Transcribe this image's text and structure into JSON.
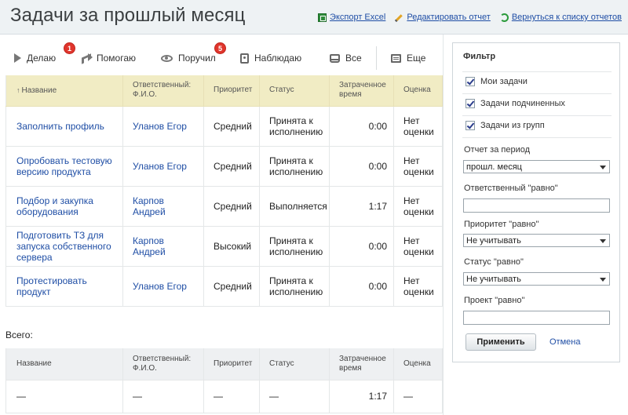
{
  "header": {
    "title": "Задачи за прошлый месяц",
    "links": [
      {
        "label": "Экспорт Excel",
        "icon": "excel-icon"
      },
      {
        "label": "Редактировать отчет",
        "icon": "pencil-icon"
      },
      {
        "label": "Вернуться к списку отчетов",
        "icon": "back-arrow-icon"
      }
    ]
  },
  "tabs": [
    {
      "label": "Делаю",
      "icon": "play-icon",
      "badge": "1"
    },
    {
      "label": "Помогаю",
      "icon": "arrow-right-icon"
    },
    {
      "label": "Поручил",
      "icon": "eye-icon",
      "badge": "5"
    },
    {
      "label": "Наблюдаю",
      "icon": "contact-book-icon"
    },
    {
      "label": "Все",
      "icon": "inbox-icon"
    },
    {
      "label": "Еще",
      "icon": "list-icon"
    }
  ],
  "table": {
    "sort_indicator": "↑",
    "columns": [
      "Название",
      "Ответственный: Ф.И.О.",
      "Приоритет",
      "Статус",
      "Затраченное время",
      "Оценка"
    ],
    "rows": [
      {
        "name": "Заполнить профиль",
        "person": "Уланов Егор",
        "priority": "Средний",
        "status": "Принята к исполнению",
        "time": "0:00",
        "rating": "Нет оценки"
      },
      {
        "name": "Опробовать тестовую версию продукта",
        "person": "Уланов Егор",
        "priority": "Средний",
        "status": "Принята к исполнению",
        "time": "0:00",
        "rating": "Нет оценки"
      },
      {
        "name": "Подбор и закупка оборудования",
        "person": "Карпов Андрей",
        "priority": "Средний",
        "status": "Выполняется",
        "time": "1:17",
        "rating": "Нет оценки"
      },
      {
        "name": "Подготовить ТЗ для запуска собственного сервера",
        "person": "Карпов Андрей",
        "priority": "Высокий",
        "status": "Принята к исполнению",
        "time": "0:00",
        "rating": "Нет оценки"
      },
      {
        "name": "Протестировать продукт",
        "person": "Уланов Егор",
        "priority": "Средний",
        "status": "Принята к исполнению",
        "time": "0:00",
        "rating": "Нет оценки"
      }
    ]
  },
  "totals": {
    "label": "Всего:",
    "columns": [
      "Название",
      "Ответственный: Ф.И.О.",
      "Приоритет",
      "Статус",
      "Затраченное время",
      "Оценка"
    ],
    "row": {
      "name": "—",
      "person": "—",
      "priority": "—",
      "status": "—",
      "time": "1:17",
      "rating": "—"
    }
  },
  "filter": {
    "title": "Фильтр",
    "checkboxes": [
      {
        "label": "Мои задачи",
        "checked": true
      },
      {
        "label": "Задачи подчиненных",
        "checked": true
      },
      {
        "label": "Задачи из групп",
        "checked": true
      }
    ],
    "period_label": "Отчет за период",
    "period_value": "прошл. месяц",
    "responsible_label": "Ответственный \"равно\"",
    "responsible_value": "",
    "priority_label": "Приоритет \"равно\"",
    "priority_value": "Не учитывать",
    "status_label": "Статус \"равно\"",
    "status_value": "Не учитывать",
    "project_label": "Проект \"равно\"",
    "project_value": "",
    "apply_label": "Применить",
    "cancel_label": "Отмена"
  },
  "colors": {
    "link": "#1f4ea5",
    "header_bg": "#eef2f4",
    "table_header_bg": "#f1ecc4",
    "badge": "#e0352c"
  }
}
